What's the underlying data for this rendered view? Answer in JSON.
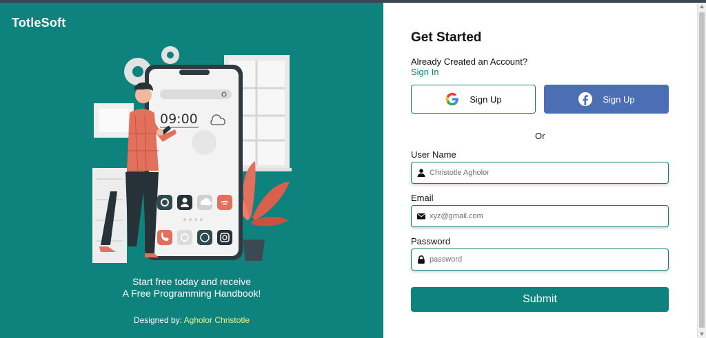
{
  "brand": "TotleSoft",
  "tagline_line1": "Start free today and receive",
  "tagline_line2": "A Free Programming Handbook!",
  "credit_prefix": "Designed by: ",
  "credit_author": "Agholor Christotle",
  "illustration": {
    "clock": "09:00"
  },
  "form": {
    "title": "Get Started",
    "already": "Already Created an Account?",
    "signin": "Sign In",
    "google_label": "Sign Up",
    "facebook_label": "Sign Up",
    "or": "Or",
    "username_label": "User Name",
    "username_placeholder": "Christotle Agholor",
    "email_label": "Email",
    "email_placeholder": "xyz@gmail.com",
    "password_label": "Password",
    "password_placeholder": "password",
    "submit": "Submit"
  },
  "colors": {
    "brand_teal": "#0e827c",
    "facebook_blue": "#4c6eb5",
    "credit_highlight": "#e9f28a"
  },
  "icons": [
    "google-icon",
    "facebook-icon",
    "user-icon",
    "envelope-icon",
    "lock-icon"
  ]
}
